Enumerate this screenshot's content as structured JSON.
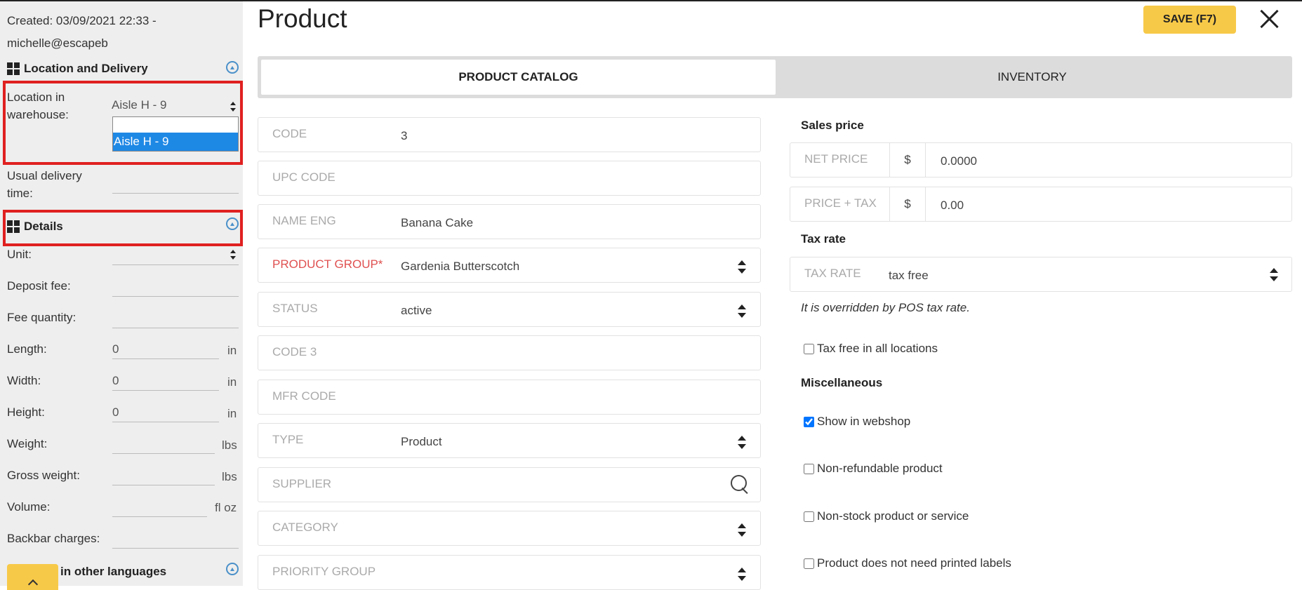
{
  "meta": {
    "created": "Created: 03/09/2021 22:33 -",
    "created_by": "michelle@escapeb"
  },
  "sidebar": {
    "location_section": {
      "title": "Location and Delivery",
      "location_label_line1": "Location in",
      "location_label_line2": "warehouse:",
      "location_value": "Aisle H - 9",
      "dropdown_options": [
        "",
        "Aisle H - 9"
      ],
      "delivery_label_line1": "Usual delivery",
      "delivery_label_line2": "time:",
      "delivery_value": ""
    },
    "details_section": {
      "title": "Details",
      "fields": [
        {
          "label": "Unit:",
          "value": "",
          "unit": ""
        },
        {
          "label": "Deposit fee:",
          "value": "",
          "unit": ""
        },
        {
          "label": "Fee quantity:",
          "value": "",
          "unit": ""
        },
        {
          "label": "Length:",
          "value": "0",
          "unit": "in"
        },
        {
          "label": "Width:",
          "value": "0",
          "unit": "in"
        },
        {
          "label": "Height:",
          "value": "0",
          "unit": "in"
        },
        {
          "label": "Weight:",
          "value": "",
          "unit": "lbs"
        },
        {
          "label": "Gross weight:",
          "value": "",
          "unit": "lbs"
        },
        {
          "label": "Volume:",
          "value": "",
          "unit": "fl oz"
        },
        {
          "label": "Backbar charges:",
          "value": "",
          "unit": ""
        }
      ]
    },
    "languages_section": {
      "title": "in other languages"
    }
  },
  "header": {
    "title": "Product",
    "save_label": "SAVE (F7)"
  },
  "tabs": [
    {
      "label": "PRODUCT CATALOG",
      "active": true
    },
    {
      "label": "INVENTORY",
      "active": false
    }
  ],
  "form": {
    "code": {
      "label": "CODE",
      "value": "3"
    },
    "upc": {
      "label": "UPC CODE",
      "value": ""
    },
    "name_eng": {
      "label": "NAME ENG",
      "value": "Banana Cake"
    },
    "product_group": {
      "label": "PRODUCT GROUP*",
      "value": "Gardenia Butterscotch"
    },
    "status": {
      "label": "STATUS",
      "value": "active"
    },
    "code3": {
      "label": "CODE 3",
      "value": ""
    },
    "mfr_code": {
      "label": "MFR CODE",
      "value": ""
    },
    "type": {
      "label": "TYPE",
      "value": "Product"
    },
    "supplier": {
      "label": "SUPPLIER",
      "value": ""
    },
    "category": {
      "label": "CATEGORY",
      "value": ""
    },
    "priority_group": {
      "label": "PRIORITY GROUP",
      "value": ""
    }
  },
  "pricing": {
    "sales_price_heading": "Sales price",
    "net_price": {
      "label": "NET PRICE",
      "currency": "$",
      "value": "0.0000"
    },
    "price_tax": {
      "label": "PRICE + TAX",
      "currency": "$",
      "value": "0.00"
    },
    "tax_rate_heading": "Tax rate",
    "tax_rate": {
      "label": "TAX RATE",
      "value": "tax free"
    },
    "tax_note": "It is overridden by POS tax rate.",
    "tax_free_all": {
      "label": "Tax free in all locations",
      "checked": false
    }
  },
  "misc": {
    "heading": "Miscellaneous",
    "options": [
      {
        "label": "Show in webshop",
        "checked": true
      },
      {
        "label": "Non-refundable product",
        "checked": false
      },
      {
        "label": "Non-stock product or service",
        "checked": false
      },
      {
        "label": "Product does not need printed labels",
        "checked": false
      }
    ]
  },
  "colors": {
    "accent": "#f7c948",
    "highlight": "#e02020",
    "selection": "#1e88e5",
    "required": "#e05050"
  }
}
